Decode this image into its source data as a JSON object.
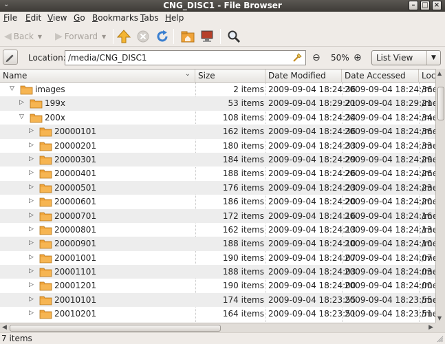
{
  "window": {
    "title": "CNG_DISC1 - File Browser"
  },
  "menubar": [
    {
      "label": "File",
      "u": "F",
      "rest": "ile"
    },
    {
      "label": "Edit",
      "u": "E",
      "rest": "dit"
    },
    {
      "label": "View",
      "u": "V",
      "rest": "iew"
    },
    {
      "label": "Go",
      "u": "G",
      "rest": "o"
    },
    {
      "label": "Bookmarks",
      "u": "B",
      "rest": "ookmarks"
    },
    {
      "label": "Tabs",
      "u": "T",
      "rest": "abs"
    },
    {
      "label": "Help",
      "u": "H",
      "rest": "elp"
    }
  ],
  "toolbar": {
    "back_label": "Back",
    "forward_label": "Forward"
  },
  "location": {
    "label": "Location:",
    "value": "/media/CNG_DISC1",
    "zoom": "50%",
    "view_mode": "List View"
  },
  "columns": {
    "name": "Name",
    "size": "Size",
    "modified": "Date Modified",
    "accessed": "Date Accessed",
    "location": "Loca"
  },
  "rows": [
    {
      "name": "images",
      "size": "2 items",
      "modified": "2009-09-04 18:24:36",
      "accessed": "2009-09-04 18:24:36",
      "loc": "/me",
      "level": 0,
      "expanded": true
    },
    {
      "name": "199x",
      "size": "53 items",
      "modified": "2009-09-04 18:29:21",
      "accessed": "2009-09-04 18:29:21",
      "loc": "/me",
      "level": 1,
      "expanded": false
    },
    {
      "name": "200x",
      "size": "108 items",
      "modified": "2009-09-04 18:24:34",
      "accessed": "2009-09-04 18:24:34",
      "loc": "/me",
      "level": 1,
      "expanded": true
    },
    {
      "name": "20000101",
      "size": "162 items",
      "modified": "2009-09-04 18:24:36",
      "accessed": "2009-09-04 18:24:36",
      "loc": "/me",
      "level": 2,
      "expanded": false
    },
    {
      "name": "20000201",
      "size": "180 items",
      "modified": "2009-09-04 18:24:33",
      "accessed": "2009-09-04 18:24:33",
      "loc": "/me",
      "level": 2,
      "expanded": false
    },
    {
      "name": "20000301",
      "size": "184 items",
      "modified": "2009-09-04 18:24:29",
      "accessed": "2009-09-04 18:24:29",
      "loc": "/me",
      "level": 2,
      "expanded": false
    },
    {
      "name": "20000401",
      "size": "188 items",
      "modified": "2009-09-04 18:24:26",
      "accessed": "2009-09-04 18:24:26",
      "loc": "/me",
      "level": 2,
      "expanded": false
    },
    {
      "name": "20000501",
      "size": "176 items",
      "modified": "2009-09-04 18:24:23",
      "accessed": "2009-09-04 18:24:23",
      "loc": "/me",
      "level": 2,
      "expanded": false
    },
    {
      "name": "20000601",
      "size": "186 items",
      "modified": "2009-09-04 18:24:20",
      "accessed": "2009-09-04 18:24:20",
      "loc": "/me",
      "level": 2,
      "expanded": false
    },
    {
      "name": "20000701",
      "size": "172 items",
      "modified": "2009-09-04 18:24:16",
      "accessed": "2009-09-04 18:24:16",
      "loc": "/me",
      "level": 2,
      "expanded": false
    },
    {
      "name": "20000801",
      "size": "162 items",
      "modified": "2009-09-04 18:24:13",
      "accessed": "2009-09-04 18:24:13",
      "loc": "/me",
      "level": 2,
      "expanded": false
    },
    {
      "name": "20000901",
      "size": "188 items",
      "modified": "2009-09-04 18:24:10",
      "accessed": "2009-09-04 18:24:10",
      "loc": "/me",
      "level": 2,
      "expanded": false
    },
    {
      "name": "20001001",
      "size": "190 items",
      "modified": "2009-09-04 18:24:07",
      "accessed": "2009-09-04 18:24:07",
      "loc": "/me",
      "level": 2,
      "expanded": false
    },
    {
      "name": "20001101",
      "size": "188 items",
      "modified": "2009-09-04 18:24:03",
      "accessed": "2009-09-04 18:24:03",
      "loc": "/me",
      "level": 2,
      "expanded": false
    },
    {
      "name": "20001201",
      "size": "190 items",
      "modified": "2009-09-04 18:24:00",
      "accessed": "2009-09-04 18:24:00",
      "loc": "/me",
      "level": 2,
      "expanded": false
    },
    {
      "name": "20010101",
      "size": "174 items",
      "modified": "2009-09-04 18:23:55",
      "accessed": "2009-09-04 18:23:55",
      "loc": "/me",
      "level": 2,
      "expanded": false
    },
    {
      "name": "20010201",
      "size": "164 items",
      "modified": "2009-09-04 18:23:51",
      "accessed": "2009-09-04 18:23:51",
      "loc": "/me",
      "level": 2,
      "expanded": false
    }
  ],
  "status": {
    "text": "7 items"
  },
  "colors": {
    "folder": "#f0a43a",
    "titlebar": "#3e3b37",
    "row_alt": "#ededed"
  }
}
